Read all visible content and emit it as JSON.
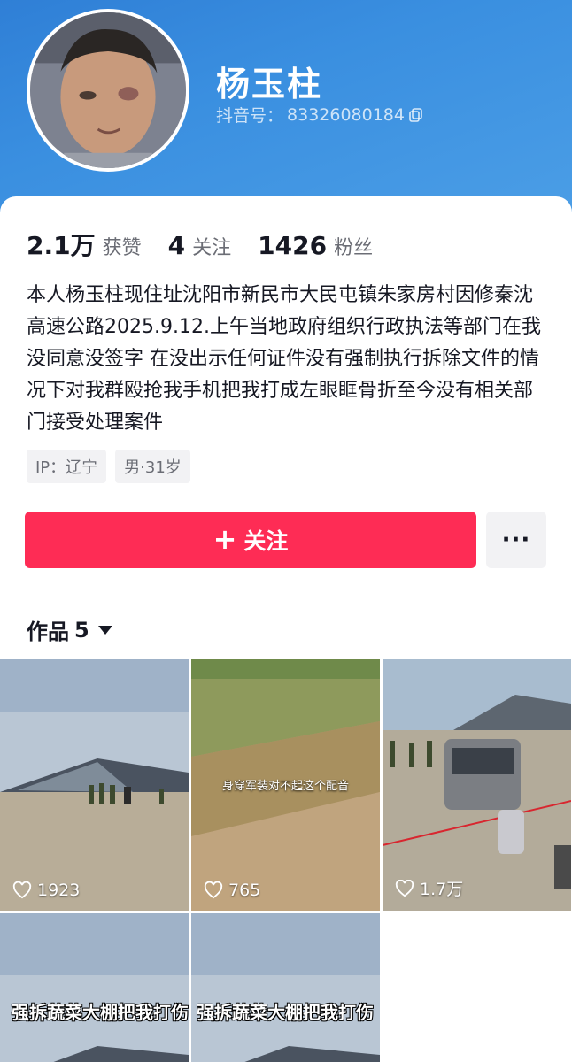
{
  "profile": {
    "nickname": "杨玉柱",
    "douyin_id_label": "抖音号：",
    "douyin_id": "83326080184"
  },
  "stats": [
    {
      "value": "2.1万",
      "label": "获赞"
    },
    {
      "value": "4",
      "label": "关注"
    },
    {
      "value": "1426",
      "label": "粉丝"
    }
  ],
  "bio": "本人杨玉柱现住址沈阳市新民市大民屯镇朱家房村因修秦沈高速公路2025.9.12.上午当地政府组织行政执法等部门在我没同意没签字 在没出示任何证件没有强制执行拆除文件的情况下对我群殴抢我手机把我打成左眼眶骨折至今没有相关部门接受处理案件",
  "tags": [
    "IP：辽宁",
    "男·31岁"
  ],
  "actions": {
    "follow_label": "关注",
    "more_label": "···"
  },
  "works": {
    "tab_label": "作品",
    "count": "5",
    "items": [
      {
        "likes": "1923",
        "caption": ""
      },
      {
        "likes": "765",
        "caption": "身穿军装对不起这个配音"
      },
      {
        "likes": "1.7万",
        "caption": ""
      },
      {
        "likes": "",
        "caption": "强拆蔬菜大棚把我打伤"
      },
      {
        "likes": "",
        "caption": "强拆蔬菜大棚把我打伤"
      }
    ]
  },
  "colors": {
    "accent": "#fe2c55",
    "header_blue": "#3a8fe0"
  }
}
